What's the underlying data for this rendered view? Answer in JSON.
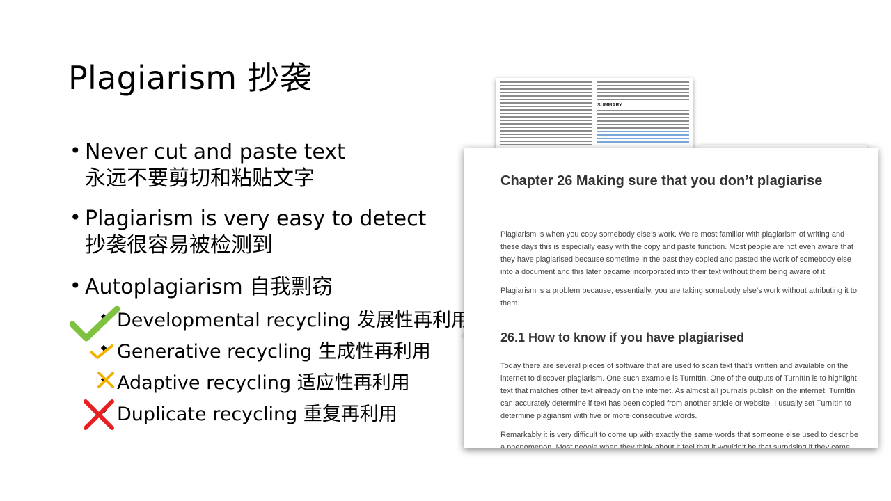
{
  "slide": {
    "title": "Plagiarism 抄袭",
    "bullets": [
      {
        "en": "Never cut and paste text",
        "zh": "永远不要剪切和粘贴文字"
      },
      {
        "en": "Plagiarism is very easy to detect",
        "zh": "抄袭很容易被检测到"
      },
      {
        "en": "Autoplagiarism  自我剽窃"
      }
    ],
    "sub_bullets": [
      {
        "label": "Developmental recycling 发展性再利用",
        "mark": "check-icon",
        "color": "#7fc241"
      },
      {
        "label": "Generative recycling 生成性再利用",
        "mark": "check-icon",
        "color": "#f2b000"
      },
      {
        "label": "Adaptive recycling 适应性再利用",
        "mark": "cross-icon",
        "color": "#f2b000"
      },
      {
        "label": "Duplicate recycling 重复再利用",
        "mark": "cross-icon",
        "color": "#e62020"
      }
    ]
  },
  "paper": {
    "summary_heading": "SUMMARY"
  },
  "book": {
    "chapter_title": "Chapter 26   Making sure that you don’t plagiarise",
    "para1": "Plagiarism is when you copy somebody else’s work. We’re most familiar with plagiarism of writing and these days this is especially easy with the copy and paste function. Most people are not even aware that they have plagiarised because sometime in the past they copied and pasted the work of somebody else into a document and this later became incorporated into their text without them being aware of it.",
    "para2": "Plagiarism is a problem because, essentially, you are taking somebody else’s work without attributing it to them.",
    "section_title": "26.1   How to know if you have plagiarised",
    "para3": "Today there are several pieces of software that are used to scan text that’s written and available on the internet to discover plagiarism. One such example is TurnItIn. One of the outputs of TurnItIn is to highlight text that matches other text already on the internet. As almost all journals publish on the internet, TurnItIn can accurately determine if text has been copied from another article or website. I usually set TurnItIn to determine plagiarism with five or more consecutive words.",
    "para4": "Remarkably it is very difficult to come up with exactly the same words that someone else used to describe a phenomenon. Most people when they think about it feel that it wouldn’t be that surprising if they came"
  },
  "chevron": "‹"
}
